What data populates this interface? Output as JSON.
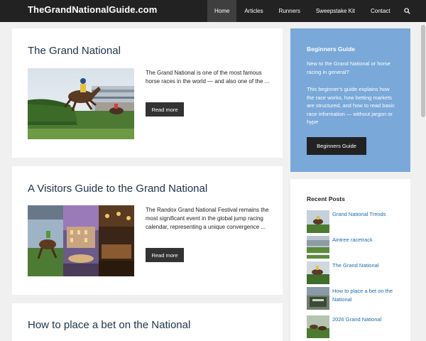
{
  "header": {
    "logo": "TheGrandNationalGuide.com",
    "nav": [
      {
        "label": "Home",
        "active": true
      },
      {
        "label": "Articles"
      },
      {
        "label": "Runners"
      },
      {
        "label": "Sweepstake Kit"
      },
      {
        "label": "Contact"
      }
    ],
    "search_icon": "search-icon"
  },
  "posts": [
    {
      "title": "The Grand National",
      "excerpt": "The Grand National is one of the most famous horse races in the world — and also one of the ...",
      "button": "Read more"
    },
    {
      "title": "A Visitors Guide to the Grand National",
      "excerpt": "The Randox Grand National Festival remains the most significant event in the global jump racing calendar, representing a unique convergence ...",
      "button": "Read more"
    },
    {
      "title": "How to place a bet on the National"
    }
  ],
  "sidebar": {
    "beginners": {
      "title": "Beginners Guide",
      "intro": "New to the Grand National or horse racing in general?",
      "body": "This beginner's guide explains how the race works, how betting markets are structured, and how to read basic race information — without jargon or hype",
      "button": "Beginners Guide"
    },
    "recent": {
      "title": "Recent Posts",
      "items": [
        {
          "label": "Grand National Trends"
        },
        {
          "label": "Aintree racetrack"
        },
        {
          "label": "The Grand National"
        },
        {
          "label": "How to place a bet on the National"
        },
        {
          "label": "2026 Grand National"
        }
      ]
    }
  },
  "colors": {
    "header_bg": "#222222",
    "beginners_bg": "#79a8d9",
    "link": "#1b6bb0",
    "title": "#1e3349"
  }
}
